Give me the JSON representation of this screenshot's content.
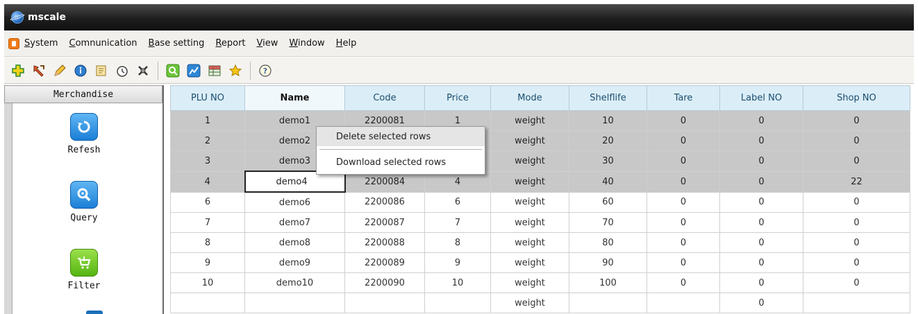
{
  "window": {
    "title": "mscale"
  },
  "menu": {
    "items": [
      {
        "first": "S",
        "rest": "ystem"
      },
      {
        "first": "C",
        "rest": "omnunication"
      },
      {
        "first": "B",
        "rest": "ase setting"
      },
      {
        "first": "R",
        "rest": "eport"
      },
      {
        "first": "V",
        "rest": "iew"
      },
      {
        "first": "W",
        "rest": "indow"
      },
      {
        "first": "H",
        "rest": "elp"
      }
    ]
  },
  "toolbar": {
    "buttons": [
      "add-icon",
      "tools-icon",
      "edit-icon",
      "info-icon",
      "note-icon",
      "clock-icon",
      "settings-icon",
      "search-icon",
      "chart-icon",
      "table-icon",
      "star-icon",
      "help-icon"
    ]
  },
  "sidebar": {
    "header": "Merchandise",
    "items": [
      {
        "label": "Refesh",
        "icon": "refresh-icon"
      },
      {
        "label": "Query",
        "icon": "magnifier-icon"
      },
      {
        "label": "Filter",
        "icon": "cart-icon"
      }
    ]
  },
  "table": {
    "columns": [
      "PLU NO",
      "Name",
      "Code",
      "Price",
      "Mode",
      "Shelflife",
      "Tare",
      "Label NO",
      "Shop NO"
    ],
    "rows": [
      [
        "1",
        "demo1",
        "2200081",
        "1",
        "weight",
        "10",
        "0",
        "0",
        "0"
      ],
      [
        "2",
        "demo2",
        "2200082",
        "2",
        "weight",
        "20",
        "0",
        "0",
        "0"
      ],
      [
        "3",
        "demo3",
        "2200083",
        "3",
        "weight",
        "30",
        "0",
        "0",
        "0"
      ],
      [
        "4",
        "demo4",
        "2200084",
        "4",
        "weight",
        "40",
        "0",
        "0",
        "22"
      ],
      [
        "6",
        "demo6",
        "2200086",
        "6",
        "weight",
        "60",
        "0",
        "0",
        "0"
      ],
      [
        "7",
        "demo7",
        "2200087",
        "7",
        "weight",
        "70",
        "0",
        "0",
        "0"
      ],
      [
        "8",
        "demo8",
        "2200088",
        "8",
        "weight",
        "80",
        "0",
        "0",
        "0"
      ],
      [
        "9",
        "demo9",
        "2200089",
        "9",
        "weight",
        "90",
        "0",
        "0",
        "0"
      ],
      [
        "10",
        "demo10",
        "2200090",
        "10",
        "weight",
        "100",
        "0",
        "0",
        "0"
      ],
      [
        "",
        "",
        "",
        "",
        "weight",
        "",
        "",
        "0",
        ""
      ]
    ],
    "selected_rows": [
      0,
      1,
      2,
      3
    ]
  },
  "context_menu": {
    "items": [
      "Delete selected rows",
      "Download selected rows"
    ]
  },
  "colors": {
    "title_bar": "#1e1e1e",
    "header_bg": "#dbeef8",
    "selected_row": "#c8c8c8",
    "nav_blue": "#1b7fd6",
    "nav_green": "#54b411"
  }
}
